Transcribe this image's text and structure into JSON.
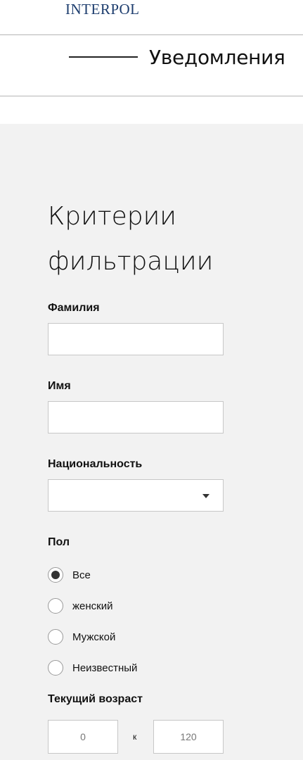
{
  "header": {
    "logo": "INTERPOL",
    "section": "Уведомления"
  },
  "filters": {
    "title": "Критерии фильтрации",
    "surname_label": "Фамилия",
    "surname_value": "",
    "name_label": "Имя",
    "name_value": "",
    "nationality_label": "Национальность",
    "nationality_value": "",
    "gender_label": "Пол",
    "gender_options": [
      "Все",
      "женский",
      "Мужской",
      "Неизвестный"
    ],
    "gender_selected": "Все",
    "age_label": "Текущий возраст",
    "age_min": "0",
    "age_separator": "к",
    "age_max": "120"
  }
}
